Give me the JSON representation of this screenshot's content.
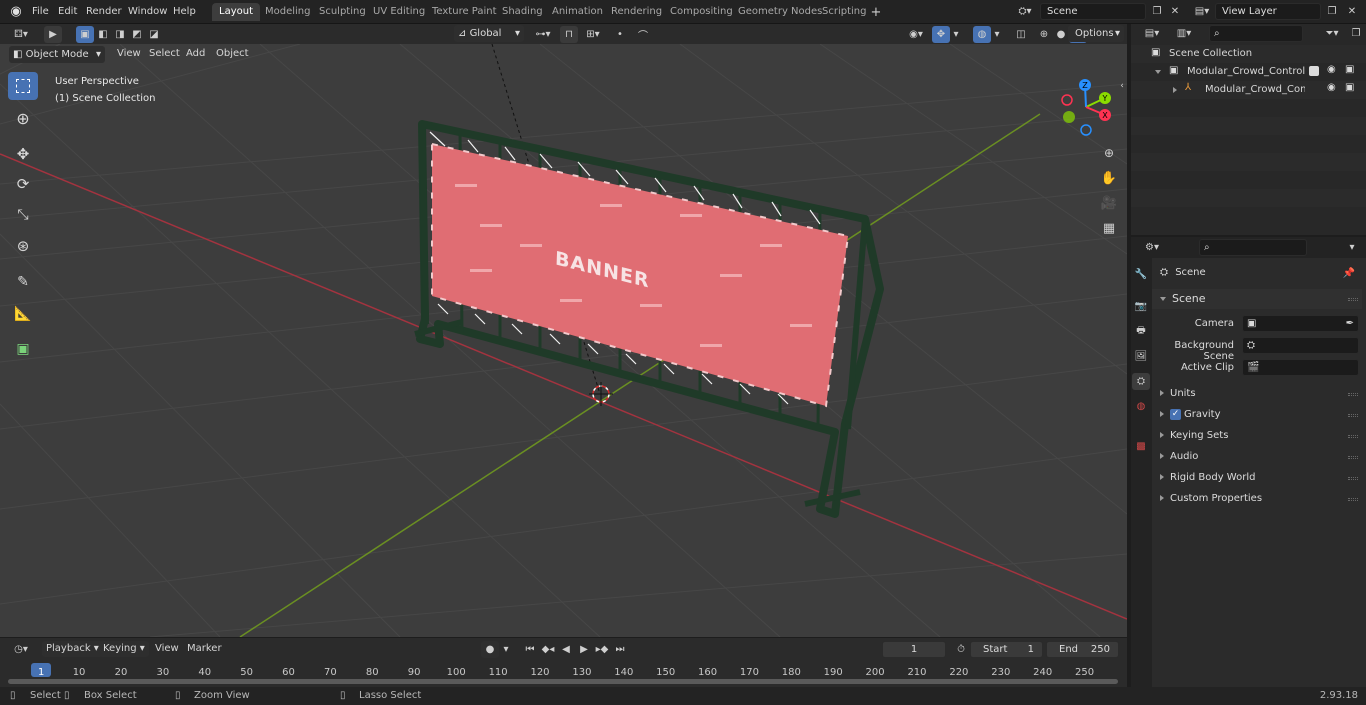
{
  "topbar": {
    "menus": [
      "File",
      "Edit",
      "Render",
      "Window",
      "Help"
    ],
    "workspaces": [
      "Layout",
      "Modeling",
      "Sculpting",
      "UV Editing",
      "Texture Paint",
      "Shading",
      "Animation",
      "Rendering",
      "Compositing",
      "Geometry Nodes",
      "Scripting"
    ],
    "active_workspace": "Layout",
    "scene_name": "Scene",
    "view_layer": "View Layer"
  },
  "viewport_header": {
    "mode": "Object Mode",
    "menus": [
      "View",
      "Select",
      "Add",
      "Object"
    ],
    "transform_orientation": "Global",
    "options_label": "Options"
  },
  "viewport": {
    "perspective_label": "User Perspective",
    "collection_label": "(1) Scene Collection",
    "banner_text": "BANNER",
    "gizmo_axes": [
      "X",
      "Y",
      "Z"
    ]
  },
  "outliner": {
    "root": "Scene Collection",
    "items": [
      {
        "label": "Modular_Crowd_Control_Barr",
        "level": 1
      },
      {
        "label": "Modular_Crowd_Control_",
        "level": 2
      }
    ]
  },
  "properties": {
    "context": "Scene",
    "panel": "Scene",
    "fields": [
      {
        "label": "Camera"
      },
      {
        "label": "Background Scene"
      },
      {
        "label": "Active Clip"
      }
    ],
    "subpanels": [
      "Units",
      "Gravity",
      "Keying Sets",
      "Audio",
      "Rigid Body World",
      "Custom Properties"
    ],
    "gravity_checked": true
  },
  "timeline": {
    "menus": [
      "Playback",
      "Keying",
      "View",
      "Marker"
    ],
    "current_frame": "1",
    "start_label": "Start",
    "start_value": "1",
    "end_label": "End",
    "end_value": "250",
    "ruler_ticks": [
      "1",
      "10",
      "20",
      "30",
      "40",
      "50",
      "60",
      "70",
      "80",
      "90",
      "100",
      "110",
      "120",
      "130",
      "140",
      "150",
      "160",
      "170",
      "180",
      "190",
      "200",
      "210",
      "220",
      "230",
      "240",
      "250"
    ]
  },
  "statusbar": {
    "items": [
      "Select",
      "Box Select",
      "Zoom View",
      "Lasso Select"
    ],
    "version": "2.93.18"
  },
  "colors": {
    "accent": "#4772b3",
    "x_axis": "#ff3352",
    "y_axis": "#8bdc00",
    "z_axis": "#2890ff",
    "banner": "#e06d73",
    "fence": "#1f3a28"
  }
}
